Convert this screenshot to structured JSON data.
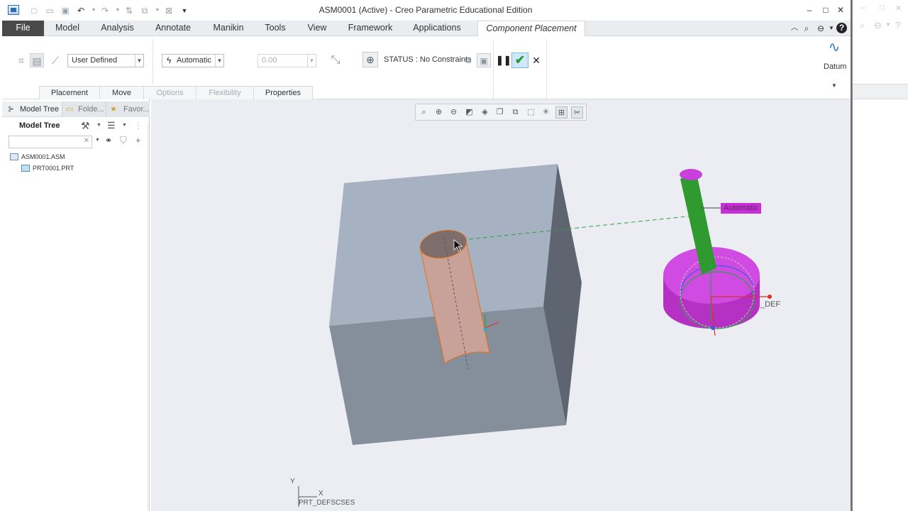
{
  "window": {
    "title": "ASM0001 (Active) - Creo Parametric Educational Edition",
    "minimize_icon": "minimize-icon",
    "maximize_icon": "maximize-icon",
    "close_icon": "close-icon"
  },
  "quick_access": [
    "new-icon",
    "open-icon",
    "save-icon",
    "undo-icon",
    "redo-icon",
    "regenerate-icon",
    "windows-icon",
    "close-window-icon",
    "customize-icon"
  ],
  "ribbon_tabs": [
    "File",
    "Model",
    "Analysis",
    "Annotate",
    "Manikin",
    "Tools",
    "View",
    "Framework",
    "Applications",
    "Component Placement"
  ],
  "ribbon": {
    "constraint_set": "User Defined",
    "constraint_type": "Automatic",
    "offset_value": "0.00",
    "status": "STATUS : No Constraints",
    "datum_label": "Datum",
    "sub_tabs": [
      "Placement",
      "Move",
      "Options",
      "Flexibility",
      "Properties"
    ]
  },
  "left_panel": {
    "tabs": [
      "Model Tree",
      "Folde...",
      "Favor..."
    ],
    "title": "Model Tree",
    "search_value": "",
    "tree": [
      "ASM0001.ASM",
      "PRT0001.PRT"
    ]
  },
  "viewport": {
    "automatic_label": "Automatic",
    "def_label": "_DEF",
    "csys_label": "PRT_DEFSCSES",
    "axis_y": "Y",
    "axis_x": "X"
  },
  "colors": {
    "file_tab": "#4a4a4a",
    "viewport_bg": "#ecedf3",
    "block_top": "#a6b1c2",
    "block_front": "#848d9a",
    "block_side": "#5e6570",
    "hole": "#c8a298",
    "part_magenta": "#c940dd",
    "part_green": "#2f9a2f",
    "highlight_orange": "#e0701c"
  }
}
